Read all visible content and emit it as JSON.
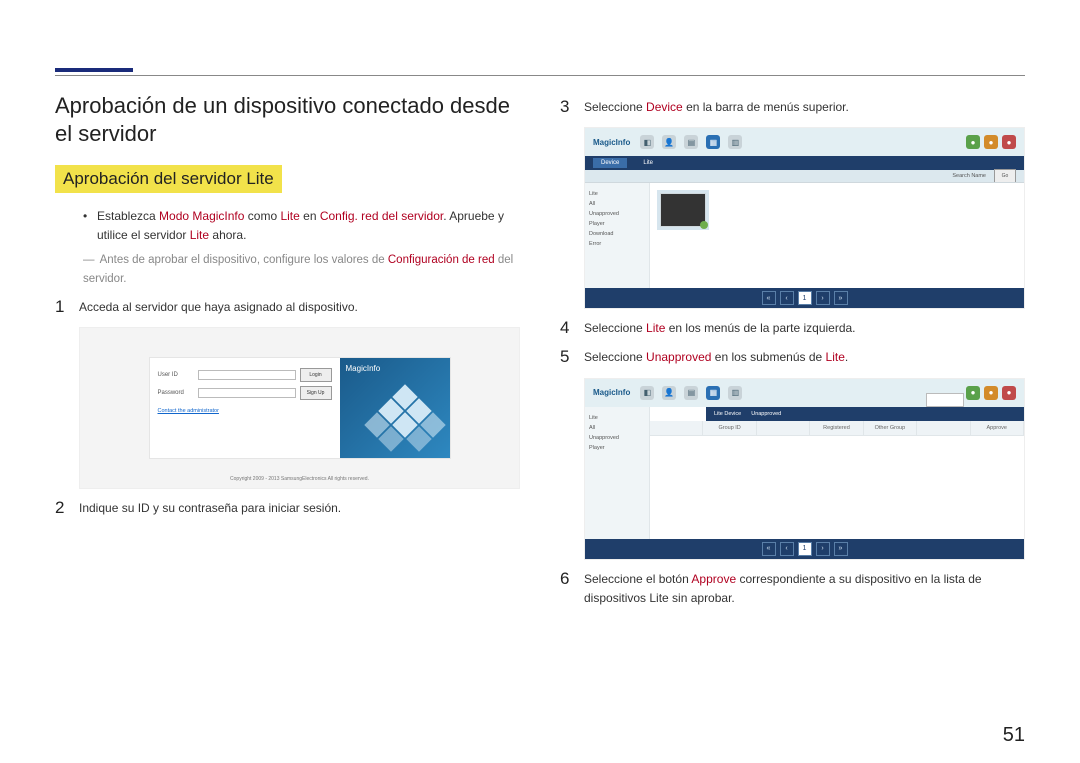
{
  "page_number": "51",
  "section_title": "Aprobación de un dispositivo conectado desde el servidor",
  "subsection_highlight": "Aprobación del servidor Lite",
  "bullet": {
    "pre": "Establezca ",
    "kw1": "Modo MagicInfo",
    "mid1": " como ",
    "kw2": "Lite",
    "mid2": " en ",
    "kw3": "Config. red del servidor",
    "post": ". Apruebe y utilice el servidor ",
    "kw4": "Lite",
    "end": " ahora."
  },
  "note_dash": "―",
  "note": {
    "pre": "Antes de aprobar el dispositivo, configure los valores de ",
    "kw": "Configuración de red",
    "post": " del servidor."
  },
  "steps": {
    "s1": {
      "num": "1",
      "text": "Acceda al servidor que haya asignado al dispositivo."
    },
    "s2": {
      "num": "2",
      "text": "Indique su ID y su contraseña para iniciar sesión."
    },
    "s3": {
      "num": "3",
      "pre": "Seleccione ",
      "kw": "Device",
      "post": " en la barra de menús superior."
    },
    "s4": {
      "num": "4",
      "pre": "Seleccione ",
      "kw": "Lite",
      "post": " en los menús de la parte izquierda."
    },
    "s5": {
      "num": "5",
      "pre": "Seleccione ",
      "kw": "Unapproved",
      "post_pre": " en los submenús de ",
      "kw2": "Lite",
      "end": "."
    },
    "s6": {
      "num": "6",
      "pre": "Seleccione el botón ",
      "kw": "Approve",
      "post": " correspondiente a su dispositivo en la lista de dispositivos Lite sin aprobar."
    }
  },
  "login": {
    "user_id_label": "User ID",
    "password_label": "Password",
    "login_btn": "Login",
    "signup_btn": "Sign Up",
    "admin_link": "Contact the administrator",
    "brand": "MagicInfo",
    "copyright": "Copyright 2009 - 2013 SamsungElectronics All rights reserved."
  },
  "app": {
    "logo": "MagicInfo",
    "tabs_a": {
      "t1": "Device",
      "t2": "Lite"
    },
    "subrow_search": "Search Name",
    "side_a": [
      "Lite",
      "All",
      "Unapproved",
      "Player",
      "Download",
      "Error"
    ],
    "side_b": [
      "Lite",
      "All",
      "Unapproved",
      "Player"
    ],
    "btn_go": "Go",
    "table_b_cols": [
      "",
      "Group ID",
      "",
      "Registered",
      "Other Group",
      "",
      "Approve"
    ],
    "tab_b": {
      "t1": "Lite Device",
      "t2": "Unapproved"
    },
    "approve_btn": "Approve"
  }
}
